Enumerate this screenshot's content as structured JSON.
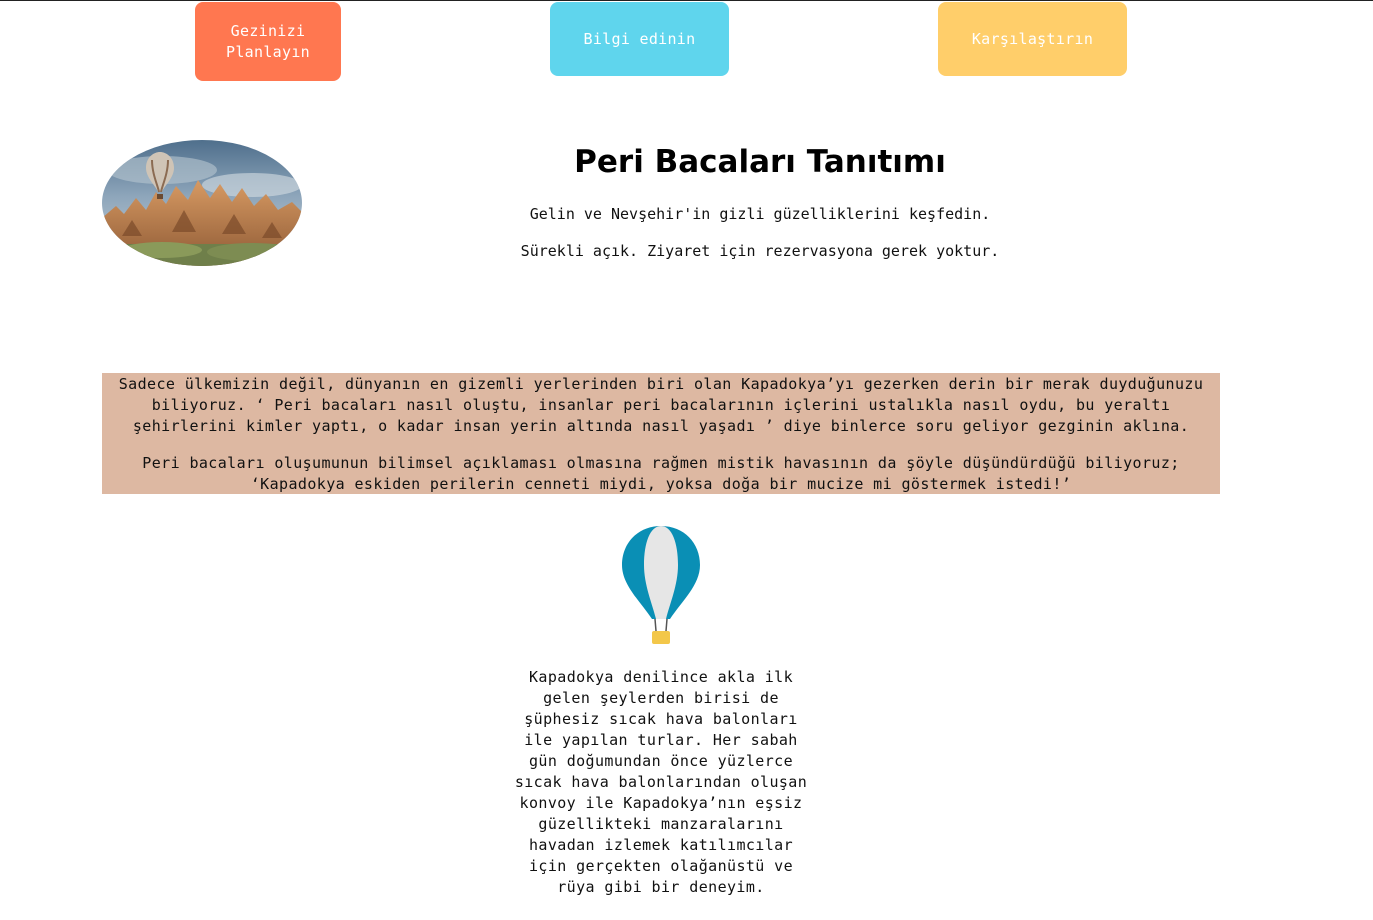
{
  "nav": {
    "plan_line1": "Gezinizi",
    "plan_line2": "Planlayın",
    "info": "Bilgi edinin",
    "compare": "Karşılaştırın"
  },
  "colors": {
    "plan_button": "#ff7750",
    "info_button": "#5fd5ed",
    "compare_button": "#ffce6a",
    "story_background": "#ddb8a2",
    "balloon_blue": "#0a8fb5",
    "balloon_white": "#e6e6e6",
    "basket_yellow": "#f3c74a"
  },
  "icons": {
    "hero_image": "cappadocia-fairy-chimneys-with-hot-air-balloon",
    "balloon": "hot-air-balloon-icon"
  },
  "header": {
    "title": "Peri Bacaları Tanıtımı",
    "subtitle": "Gelin ve Nevşehir'in gizli güzelliklerini keşfedin.",
    "note": "Sürekli açık. Ziyaret için rezervasyona gerek yoktur."
  },
  "story": {
    "line1": "Sadece ülkemizin değil, dünyanın en gizemli yerlerinden biri olan Kapadokya’yı gezerken derin bir merak duyduğunuzu",
    "line2": "biliyoruz. ‘ Peri bacaları nasıl oluştu, insanlar peri bacalarının içlerini ustalıkla nasıl oydu, bu yeraltı",
    "line3": "şehirlerini kimler yaptı, o kadar insan yerin altında nasıl yaşadı ’ diye binlerce soru geliyor gezginin aklına.",
    "line4": "Peri bacaları oluşumunun bilimsel açıklaması olmasına rağmen mistik havasının da şöyle düşündürdüğü biliyoruz;",
    "line5": "‘Kapadokya eskiden perilerin cenneti miydi, yoksa doğa bir mucize mi göstermek istedi!’"
  },
  "balloon_section": {
    "lines": [
      "Kapadokya denilince akla ilk",
      "gelen şeylerden birisi de",
      "şüphesiz sıcak hava balonları",
      "ile yapılan turlar. Her sabah",
      "gün doğumundan önce yüzlerce",
      "sıcak hava balonlarından oluşan",
      "konvoy ile Kapadokya’nın eşsiz",
      "güzellikteki manzaralarını",
      "havadan izlemek katılımcılar",
      "için gerçekten olağanüstü ve",
      "rüya gibi bir deneyim."
    ]
  }
}
